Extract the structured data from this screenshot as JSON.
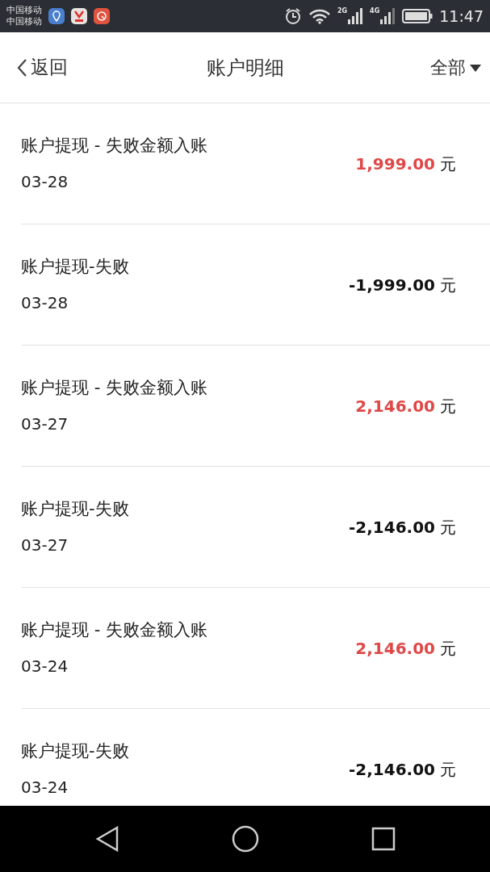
{
  "status_bar": {
    "carriers": [
      "中国移动",
      "中国移动"
    ],
    "network_labels": [
      "2G",
      "4G"
    ],
    "time": "11:47"
  },
  "header": {
    "back": "返回",
    "title": "账户明细",
    "filter": "全部"
  },
  "records": [
    {
      "title": "账户提现 - 失败金额入账",
      "date": "03-28",
      "amount": "1,999.00",
      "unit": "元",
      "kind": "income"
    },
    {
      "title": "账户提现-失败",
      "date": "03-28",
      "amount": "-1,999.00",
      "unit": "元",
      "kind": "expense"
    },
    {
      "title": "账户提现 - 失败金额入账",
      "date": "03-27",
      "amount": "2,146.00",
      "unit": "元",
      "kind": "income"
    },
    {
      "title": "账户提现-失败",
      "date": "03-27",
      "amount": "-2,146.00",
      "unit": "元",
      "kind": "expense"
    },
    {
      "title": "账户提现 - 失败金额入账",
      "date": "03-24",
      "amount": "2,146.00",
      "unit": "元",
      "kind": "income"
    },
    {
      "title": "账户提现-失败",
      "date": "03-24",
      "amount": "-2,146.00",
      "unit": "元",
      "kind": "expense"
    }
  ]
}
